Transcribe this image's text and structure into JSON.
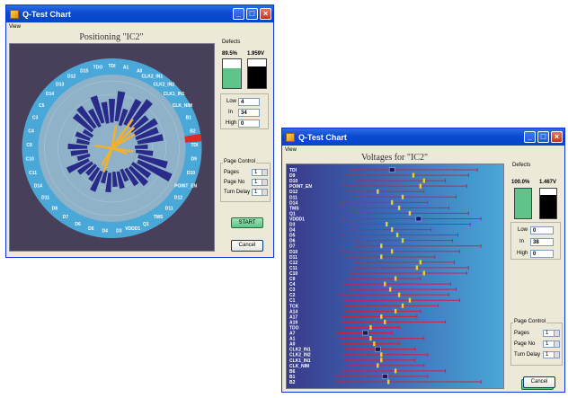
{
  "win1": {
    "title": "Q-Test Chart",
    "menu": "View",
    "chart_title": "Positioning \"IC2\"",
    "defects_label": "Defects",
    "pct_left": "89.5%",
    "pct_right": "1.959V",
    "low_label": "Low",
    "low_value": "4",
    "in_label": "In",
    "in_value": "34",
    "high_label": "High",
    "high_value": "0",
    "page_control_label": "Page Control",
    "pages_label": "Pages",
    "pages_value": "1",
    "page_no_label": "Page No",
    "page_no_value": "1",
    "turn_delay_label": "Turn Delay",
    "turn_delay_value": "1",
    "start_label": "START",
    "cancel_label": "Cancel",
    "colors": {
      "plot_bg": "#48405a",
      "ring": "#4aa8d8",
      "bar": "#2a2a8a",
      "needle": "#f0b030",
      "alert": "#e02828"
    }
  },
  "win2": {
    "title": "Q-Test Chart",
    "menu": "View",
    "chart_title": "Voltages for \"IC2\"",
    "defects_label": "Defects",
    "pct_left": "100.0%",
    "pct_right": "1.467V",
    "low_label": "Low",
    "low_value": "0",
    "in_label": "In",
    "in_value": "38",
    "high_label": "High",
    "high_value": "0",
    "page_control_label": "Page Control",
    "pages_label": "Pages",
    "pages_value": "1",
    "page_no_label": "Page No",
    "page_no_value": "1",
    "turn_delay_label": "Turn Delay",
    "turn_delay_value": "1",
    "start_label": "START",
    "cancel_label": "Cancel",
    "colors": {
      "bg_left": "#3a3a8a",
      "bg_right": "#4aa8d8",
      "line": "#d02040",
      "marker": "#f0d020"
    }
  },
  "chart_data": [
    {
      "type": "radial-bar",
      "categories": [
        "TDI",
        "A1",
        "A0",
        "CLK2_IN1",
        "CLK2_IN2",
        "CLK1_IN1",
        "CLK_NIM",
        "B1",
        "B2",
        "TDI",
        "D9",
        "D10",
        "POINT_EN",
        "D12",
        "D11",
        "TMS",
        "Q1",
        "VDDD1",
        "D3",
        "D4",
        "D5",
        "D6",
        "D7",
        "D8",
        "D11",
        "D14",
        "C11",
        "C10",
        "C9",
        "C4",
        "C3",
        "C5",
        "D14",
        "D13",
        "D12",
        "D15",
        "TDO"
      ],
      "values": [
        0.55,
        0.7,
        0.4,
        0.65,
        0.75,
        0.5,
        0.6,
        0.55,
        0.6,
        0.3,
        0.4,
        0.7,
        0.85,
        0.5,
        0.55,
        0.45,
        0.3,
        0.4,
        0.35,
        0.45,
        0.3,
        0.5,
        0.35,
        0.3,
        0.4,
        0.55,
        0.3,
        0.4,
        0.45,
        0.3,
        0.35,
        0.25,
        0.55,
        0.6,
        0.45,
        0.65,
        0.5
      ]
    },
    {
      "type": "range-plot",
      "categories": [
        "TDI",
        "D9",
        "D10",
        "POINT_EN",
        "D12",
        "D11",
        "D14",
        "TMS",
        "Q1",
        "VDDD1",
        "D3",
        "D4",
        "D5",
        "D6",
        "D7",
        "D10",
        "D11",
        "C12",
        "C11",
        "C10",
        "C9",
        "C4",
        "C3",
        "C2",
        "C1",
        "TCK",
        "A14",
        "A17",
        "A19",
        "TDO",
        "A7",
        "A1",
        "A0",
        "CLK2_IN1",
        "CLK2_IN2",
        "CLK1_IN1",
        "CLK_NIM",
        "B6",
        "B1",
        "B2"
      ],
      "min": [
        0.18,
        0.15,
        0.22,
        0.14,
        0.16,
        0.2,
        0.12,
        0.17,
        0.19,
        0.14,
        0.16,
        0.18,
        0.14,
        0.22,
        0.2,
        0.13,
        0.16,
        0.21,
        0.2,
        0.18,
        0.17,
        0.14,
        0.18,
        0.12,
        0.15,
        0.14,
        0.16,
        0.14,
        0.13,
        0.15,
        0.11,
        0.12,
        0.13,
        0.16,
        0.14,
        0.15,
        0.17,
        0.13,
        0.1,
        0.1
      ],
      "max": [
        0.9,
        0.85,
        0.72,
        0.84,
        0.6,
        0.78,
        0.62,
        0.74,
        0.85,
        0.92,
        0.86,
        0.64,
        0.79,
        0.76,
        0.92,
        0.8,
        0.66,
        0.77,
        0.85,
        0.84,
        0.58,
        0.75,
        0.78,
        0.74,
        0.8,
        0.68,
        0.58,
        0.56,
        0.72,
        0.46,
        0.42,
        0.6,
        0.46,
        0.55,
        0.62,
        0.55,
        0.6,
        0.72,
        0.62,
        0.92
      ],
      "value": [
        0.42,
        0.54,
        0.6,
        0.58,
        0.34,
        0.48,
        0.42,
        0.46,
        0.52,
        0.57,
        0.39,
        0.42,
        0.45,
        0.48,
        0.36,
        0.42,
        0.36,
        0.58,
        0.56,
        0.6,
        0.44,
        0.38,
        0.41,
        0.46,
        0.52,
        0.48,
        0.44,
        0.36,
        0.38,
        0.3,
        0.27,
        0.3,
        0.32,
        0.34,
        0.36,
        0.36,
        0.34,
        0.44,
        0.38,
        0.4
      ],
      "defect": [
        1,
        0,
        0,
        0,
        0,
        0,
        0,
        0,
        0,
        1,
        0,
        0,
        0,
        0,
        0,
        0,
        0,
        0,
        0,
        0,
        0,
        0,
        0,
        0,
        0,
        0,
        0,
        0,
        0,
        0,
        1,
        0,
        0,
        1,
        0,
        0,
        0,
        0,
        1,
        0
      ]
    }
  ]
}
